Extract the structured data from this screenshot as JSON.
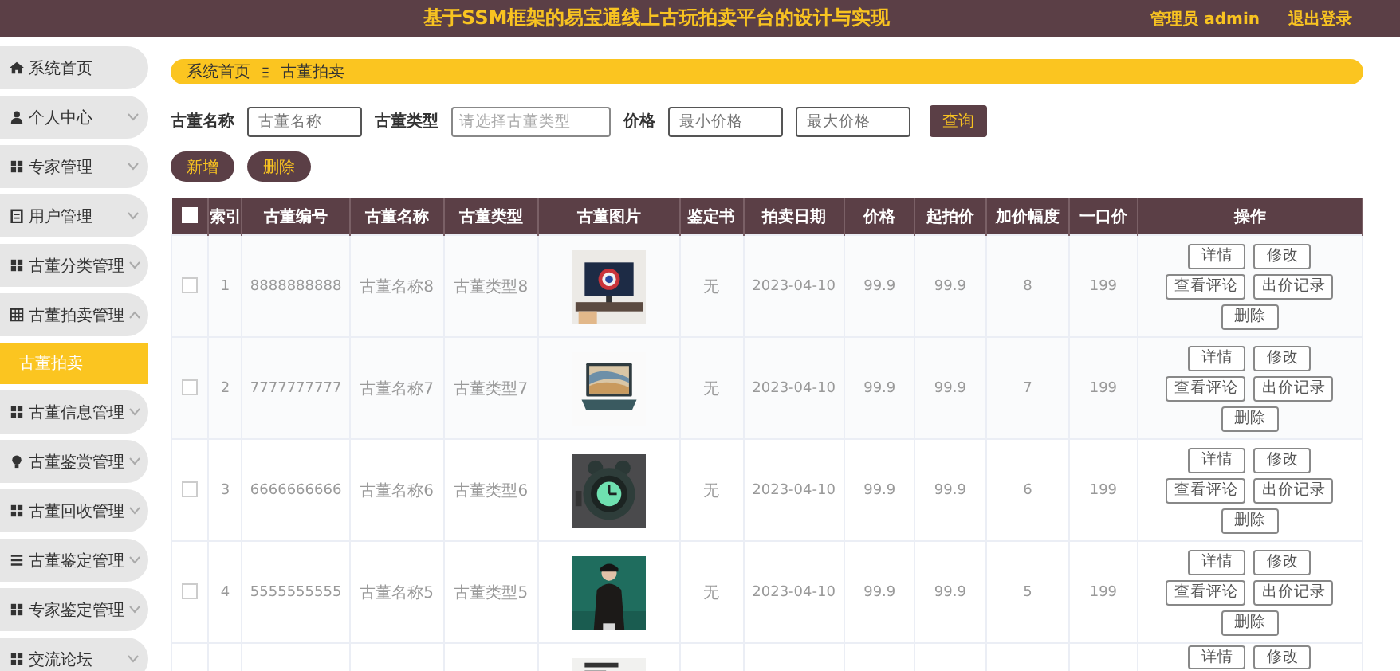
{
  "header": {
    "title": "基于SSM框架的易宝通线上古玩拍卖平台的设计与实现",
    "user": "管理员 admin",
    "logout": "退出登录"
  },
  "sidebar": {
    "items": [
      {
        "kind": "link",
        "label": "系统首页"
      },
      {
        "kind": "menu",
        "label": "个人中心",
        "expanded": false
      },
      {
        "kind": "menu",
        "label": "专家管理",
        "expanded": false
      },
      {
        "kind": "menu",
        "label": "用户管理",
        "expanded": false
      },
      {
        "kind": "menu",
        "label": "古董分类管理",
        "expanded": false
      },
      {
        "kind": "menu",
        "label": "古董拍卖管理",
        "expanded": true,
        "children": [
          {
            "label": "古董拍卖",
            "selected": true
          }
        ]
      },
      {
        "kind": "menu",
        "label": "古董信息管理",
        "expanded": false
      },
      {
        "kind": "menu",
        "label": "古董鉴赏管理",
        "expanded": false
      },
      {
        "kind": "menu",
        "label": "古董回收管理",
        "expanded": false
      },
      {
        "kind": "menu",
        "label": "古董鉴定管理",
        "expanded": false
      },
      {
        "kind": "menu",
        "label": "专家鉴定管理",
        "expanded": false
      },
      {
        "kind": "menu",
        "label": "交流论坛",
        "expanded": false
      }
    ]
  },
  "breadcrumb": [
    "系统首页",
    "古董拍卖"
  ],
  "filters": {
    "name_label": "古董名称",
    "name_placeholder": "古董名称",
    "type_label": "古董类型",
    "type_placeholder": "请选择古董类型",
    "price_label": "价格",
    "min_placeholder": "最小价格",
    "max_placeholder": "最大价格",
    "search_button": "查询"
  },
  "toolbar": [
    "新增",
    "删除"
  ],
  "table": {
    "select_all_checked": false,
    "columns": [
      "索引",
      "古董编号",
      "古董名称",
      "古董类型",
      "古董图片",
      "鉴定书",
      "拍卖日期",
      "价格",
      "起拍价",
      "加价幅度",
      "一口价",
      "操作"
    ],
    "rows": [
      {
        "checked": false,
        "cells": [
          "1",
          "8888888888",
          "古董名称8",
          "古董类型8",
          "无",
          "2023-04-10",
          "99.9",
          "99.9",
          "8",
          "199"
        ],
        "actions": [
          "详情",
          "修改",
          "查看评论",
          "出价记录",
          "删除"
        ]
      },
      {
        "checked": false,
        "cells": [
          "2",
          "7777777777",
          "古董名称7",
          "古董类型7",
          "无",
          "2023-04-10",
          "99.9",
          "99.9",
          "7",
          "199"
        ],
        "actions": [
          "详情",
          "修改",
          "查看评论",
          "出价记录",
          "删除"
        ]
      },
      {
        "checked": false,
        "cells": [
          "3",
          "6666666666",
          "古董名称6",
          "古董类型6",
          "无",
          "2023-04-10",
          "99.9",
          "99.9",
          "6",
          "199"
        ],
        "actions": [
          "详情",
          "修改",
          "查看评论",
          "出价记录",
          "删除"
        ]
      },
      {
        "checked": false,
        "cells": [
          "4",
          "5555555555",
          "古董名称5",
          "古董类型5",
          "无",
          "2023-04-10",
          "99.9",
          "99.9",
          "5",
          "199"
        ],
        "actions": [
          "详情",
          "修改",
          "查看评论",
          "出价记录",
          "删除"
        ]
      },
      {
        "actions": [
          "详情",
          "修改"
        ]
      }
    ]
  }
}
